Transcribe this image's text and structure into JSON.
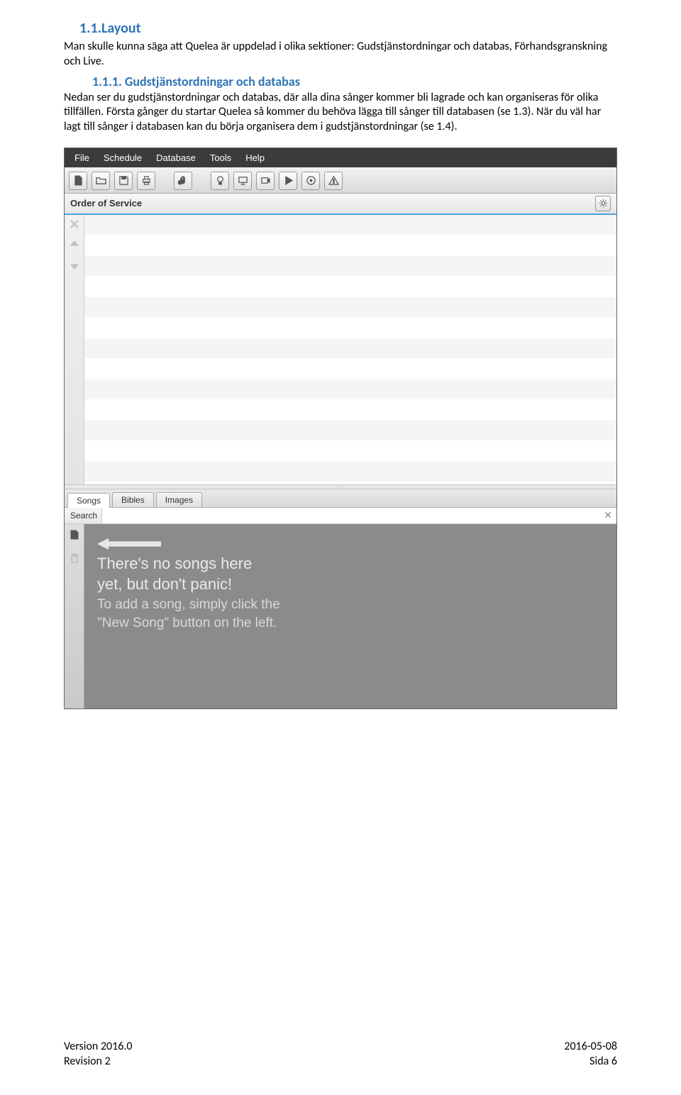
{
  "doc": {
    "h1": "1.1.Layout",
    "p1": "Man skulle kunna säga att Quelea är uppdelad i olika sektioner: Gudstjänstordningar och databas, Förhandsgranskning och Live.",
    "h2": "1.1.1. Gudstjänstordningar och databas",
    "p2": "Nedan ser du gudstjänstordningar och databas, där alla dina sånger kommer bli lagrade och kan organiseras för olika tillfällen. Första gånger du startar Quelea så kommer du behöva lägga till sånger till databasen (se 1.3). När du väl har lagt till sånger i databasen kan du börja organisera dem i gudstjänstordningar (se 1.4)."
  },
  "app": {
    "menu": {
      "file": "File",
      "schedule": "Schedule",
      "database": "Database",
      "tools": "Tools",
      "help": "Help"
    },
    "panel_title": "Order of Service",
    "tabs": {
      "songs": "Songs",
      "bibles": "Bibles",
      "images": "Images"
    },
    "search_label": "Search",
    "empty_main": "There's no songs here\nyet, but don't panic!",
    "empty_sub": "To add a song, simply click the\n\"New Song\" button on the left."
  },
  "footer": {
    "version": "Version 2016.0",
    "revision": "Revision 2",
    "date": "2016-05-08",
    "page": "Sida 6"
  }
}
